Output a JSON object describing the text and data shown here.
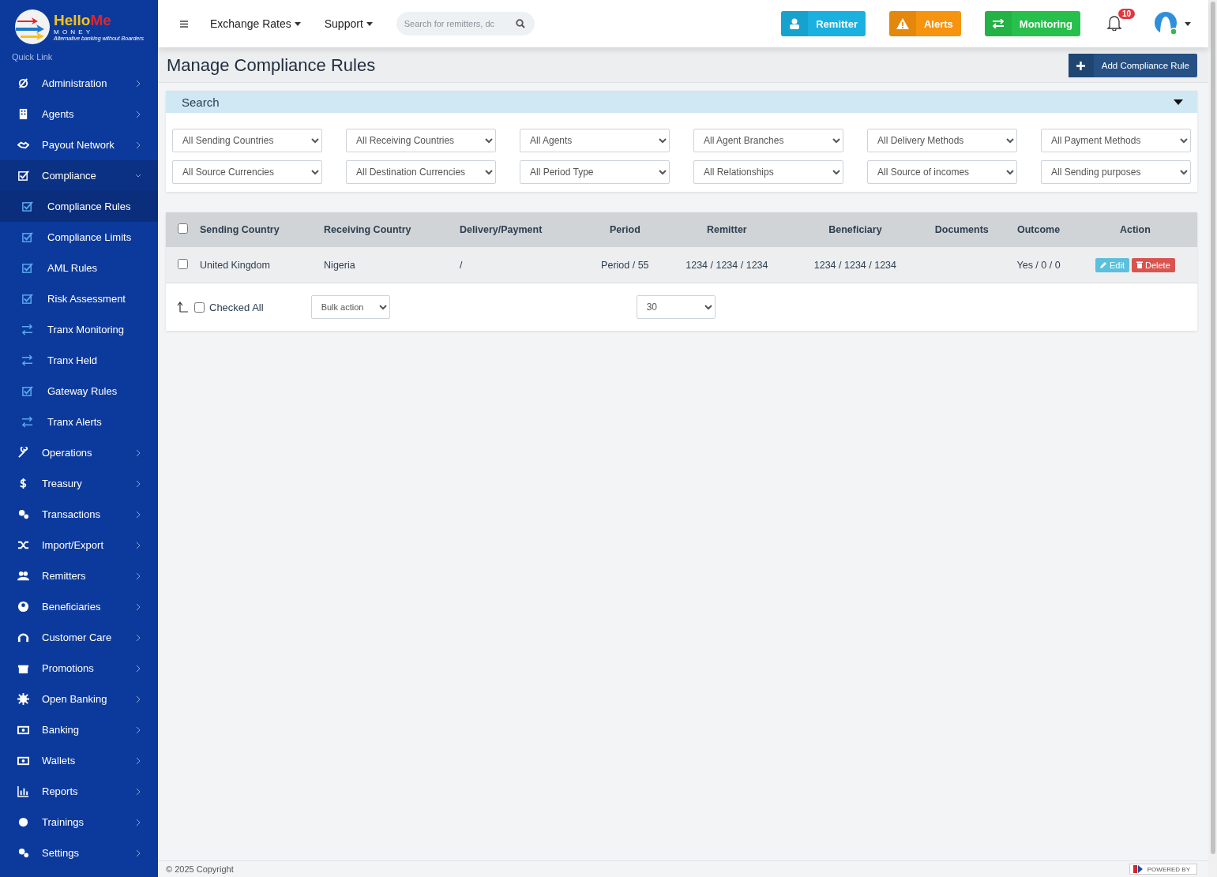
{
  "logo": {
    "word_a": "Hello",
    "word_b": "Me",
    "subword": "M O N E Y",
    "tagline": "Alternative banking without Boarders"
  },
  "sidebar": {
    "heading": "Quick Link",
    "items": [
      {
        "label": "Administration",
        "expanded": false
      },
      {
        "label": "Agents",
        "expanded": false
      },
      {
        "label": "Payout Network",
        "expanded": false
      },
      {
        "label": "Compliance",
        "expanded": true,
        "children": [
          {
            "label": "Compliance Rules",
            "selected": true
          },
          {
            "label": "Compliance Limits",
            "selected": false
          },
          {
            "label": "AML Rules",
            "selected": false
          },
          {
            "label": "Risk Assessment",
            "selected": false
          },
          {
            "label": "Tranx Monitoring",
            "selected": false
          },
          {
            "label": "Tranx Held",
            "selected": false
          },
          {
            "label": "Gateway Rules",
            "selected": false
          },
          {
            "label": "Tranx Alerts",
            "selected": false
          }
        ]
      },
      {
        "label": "Operations",
        "expanded": false
      },
      {
        "label": "Treasury",
        "expanded": false
      },
      {
        "label": "Transactions",
        "expanded": false
      },
      {
        "label": "Import/Export",
        "expanded": false
      },
      {
        "label": "Remitters",
        "expanded": false
      },
      {
        "label": "Beneficiaries",
        "expanded": false
      },
      {
        "label": "Customer Care",
        "expanded": false
      },
      {
        "label": "Promotions",
        "expanded": false
      },
      {
        "label": "Open Banking",
        "expanded": false
      },
      {
        "label": "Banking",
        "expanded": false
      },
      {
        "label": "Wallets",
        "expanded": false
      },
      {
        "label": "Reports",
        "expanded": false
      },
      {
        "label": "Trainings",
        "expanded": false
      },
      {
        "label": "Settings",
        "expanded": false
      }
    ]
  },
  "topbar": {
    "menus": [
      "Exchange Rates",
      "Support"
    ],
    "search": {
      "placeholder": "Search for remitters, dc"
    },
    "buttons": [
      {
        "label": "Remitter",
        "kind": "remitter"
      },
      {
        "label": "Alerts",
        "kind": "alerts"
      },
      {
        "label": "Monitoring",
        "kind": "monitoring"
      }
    ],
    "notifications": "10"
  },
  "page": {
    "title": "Manage Compliance Rules",
    "add_button": "Add Compliance Rule"
  },
  "search_panel": {
    "title": "Search",
    "expanded": true,
    "filters": [
      "All Sending Countries",
      "All Receiving Countries",
      "All Agents",
      "All Agent Branches",
      "All Delivery Methods",
      "All Payment Methods",
      "All Source Currencies",
      "All Destination Currencies",
      "All Period Type",
      "All Relationships",
      "All Source of incomes",
      "All Sending purposes"
    ]
  },
  "table": {
    "columns": [
      "Sending Country",
      "Receiving Country",
      "Delivery/Payment",
      "Period",
      "Remitter",
      "Beneficiary",
      "Documents",
      "Outcome",
      "Action"
    ],
    "rows": [
      {
        "checked": false,
        "cells": [
          "United Kingdom",
          "Nigeria",
          "/",
          "Period / 55",
          "1234 / 1234 / 1234",
          "1234 / 1234 / 1234",
          "",
          "Yes / 0 / 0"
        ],
        "actions": [
          "Edit",
          "Delete"
        ]
      }
    ],
    "select_all_checked": false,
    "footer": {
      "checked_all_label": "Checked All",
      "checked_all": false,
      "bulk_action": "Bulk action",
      "page_size": "30"
    }
  },
  "footer": {
    "copyright": "© 2025 Copyright",
    "powered_by": "POWERED BY"
  }
}
